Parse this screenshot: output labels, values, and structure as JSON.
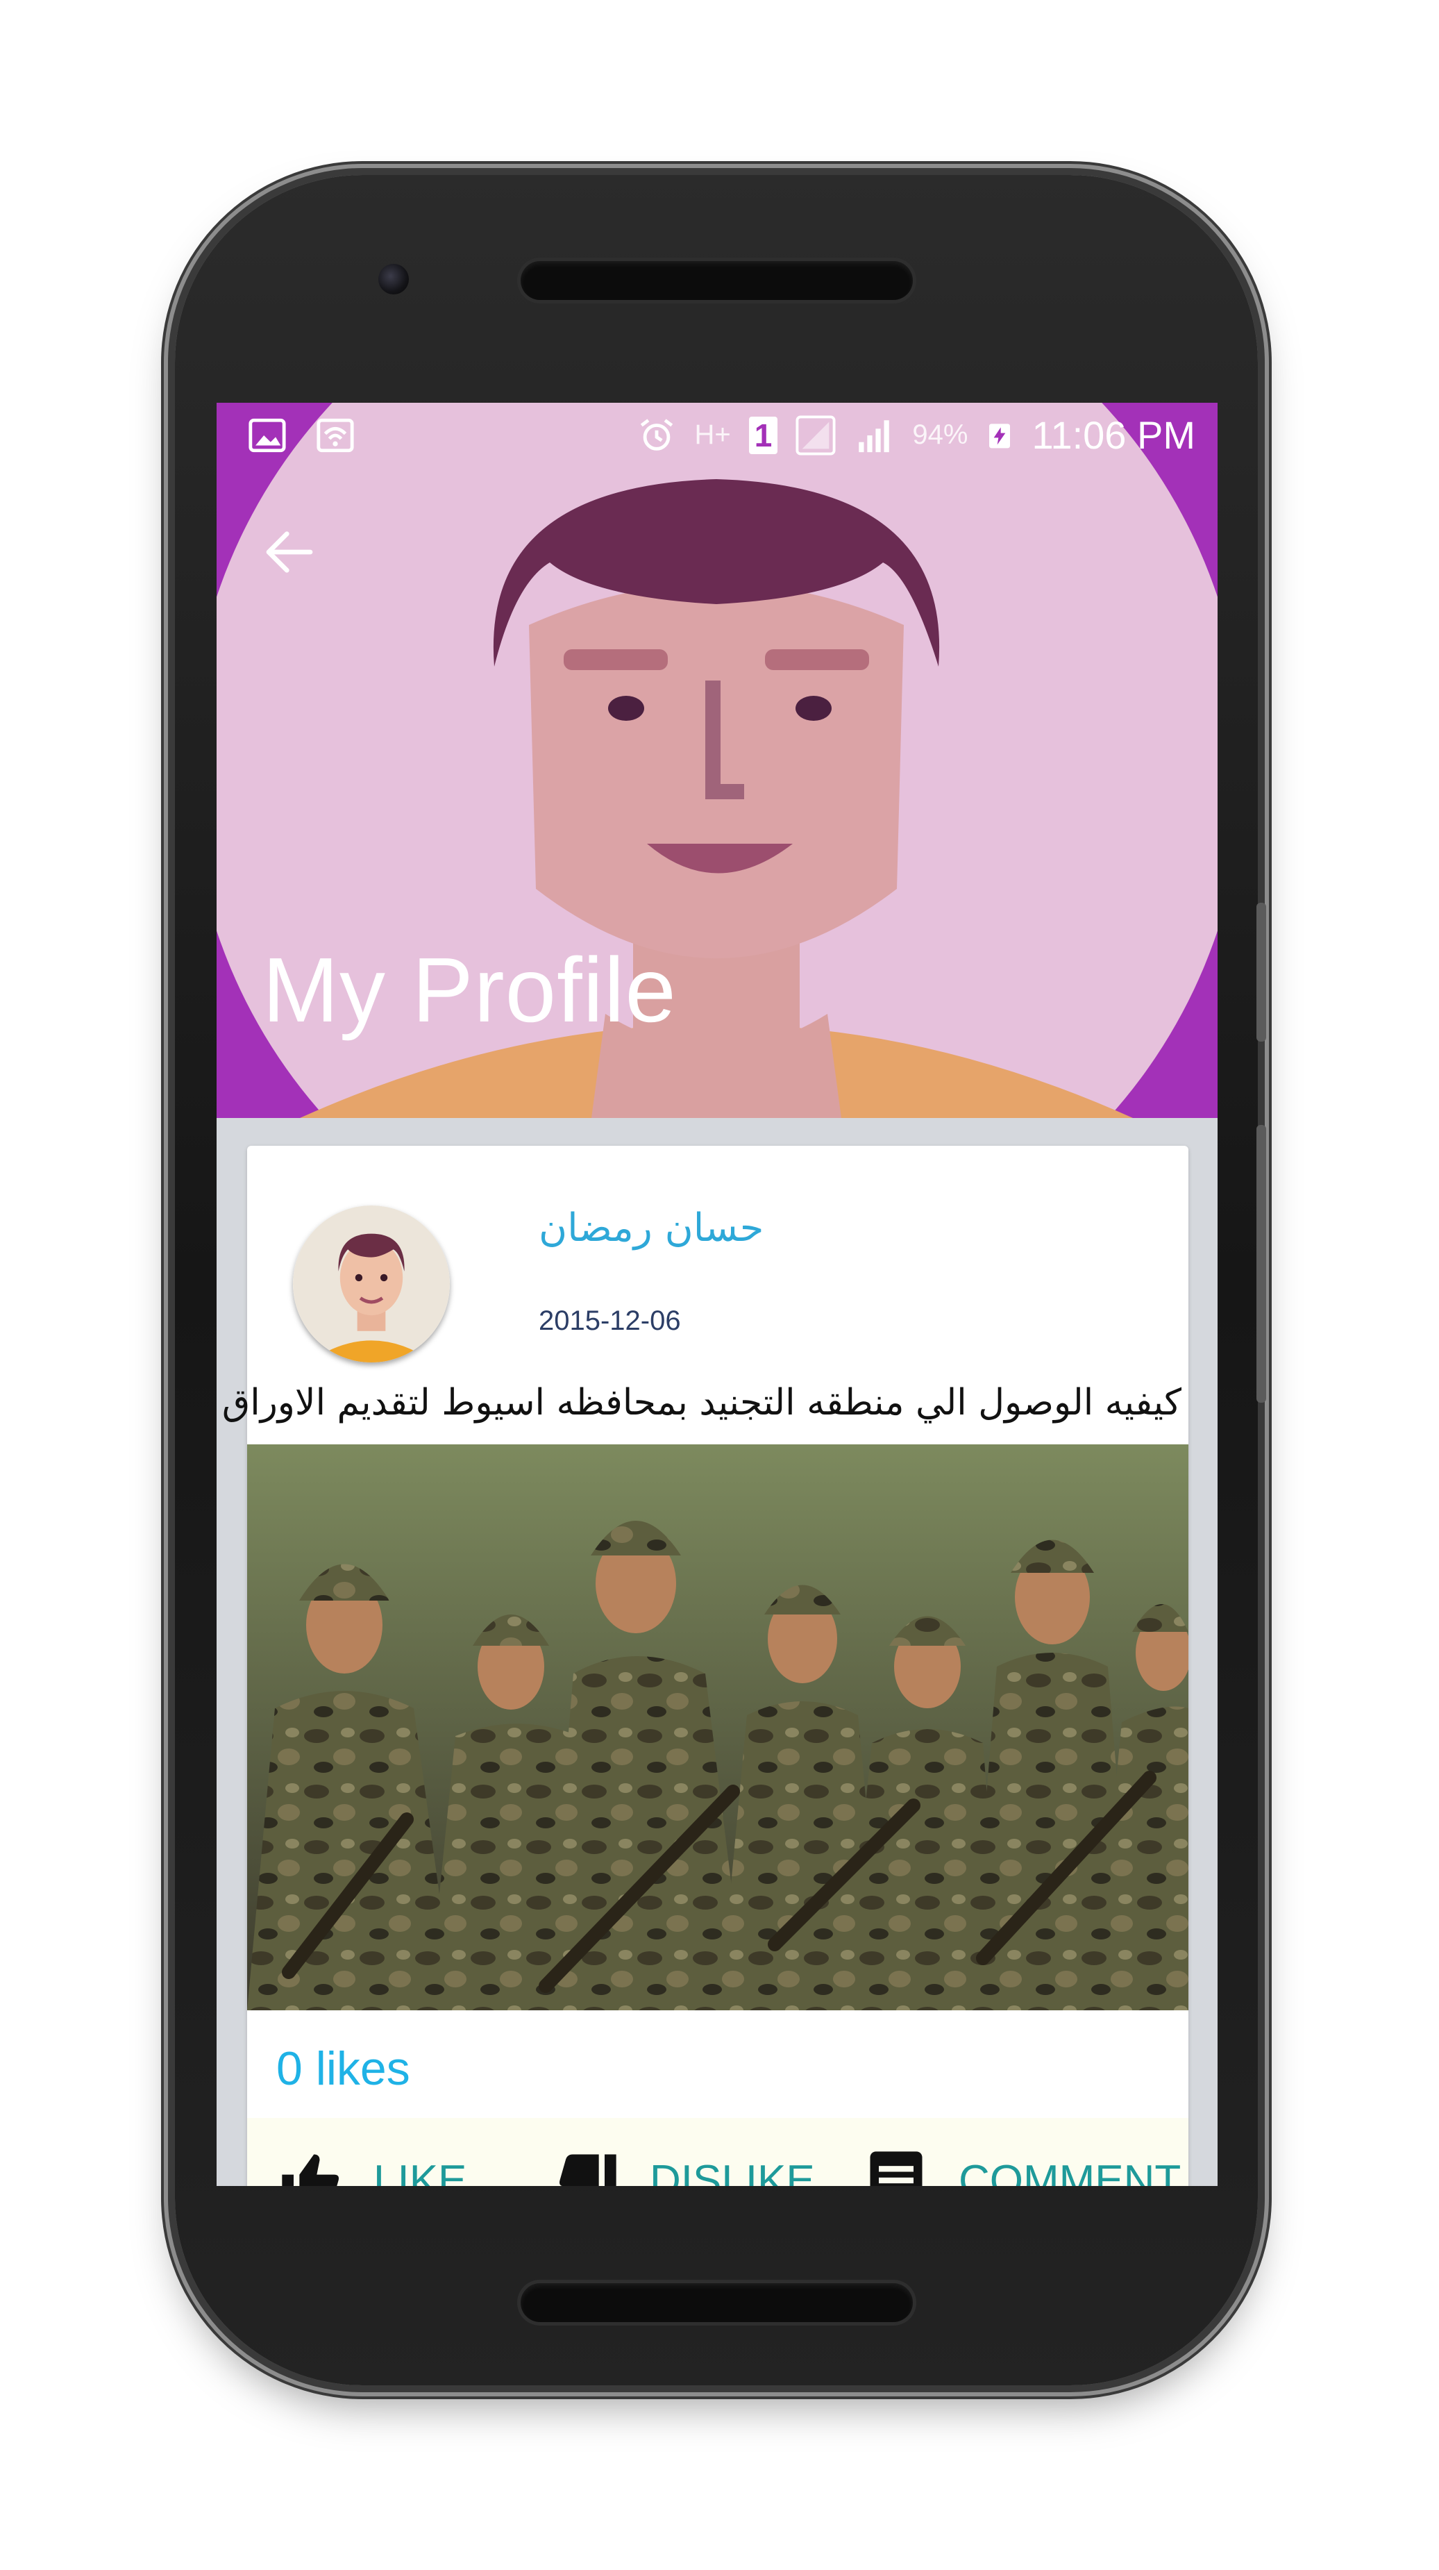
{
  "status_bar": {
    "battery": "94%",
    "time": "11:06 PM",
    "network_label": "H+",
    "sim_label": "1"
  },
  "header": {
    "title": "My Profile"
  },
  "post": {
    "author": "حسان  رمضان",
    "date": "2015-12-06",
    "text": "كيفيه الوصول الي منطقه التجنيد بمحافظه اسيوط لتقديم الاوراق",
    "likes": "0 likes"
  },
  "actions": {
    "like": "LIKE",
    "dislike": "DISLIKE",
    "comment": "COMMENT"
  },
  "colors": {
    "header": "#a331b8",
    "accent": "#1fb2e6",
    "action": "#1e9a9a"
  },
  "icons": {
    "back": "arrow-back-icon",
    "like": "thumb-up-icon",
    "dislike": "thumb-down-icon",
    "comment": "comment-icon"
  }
}
